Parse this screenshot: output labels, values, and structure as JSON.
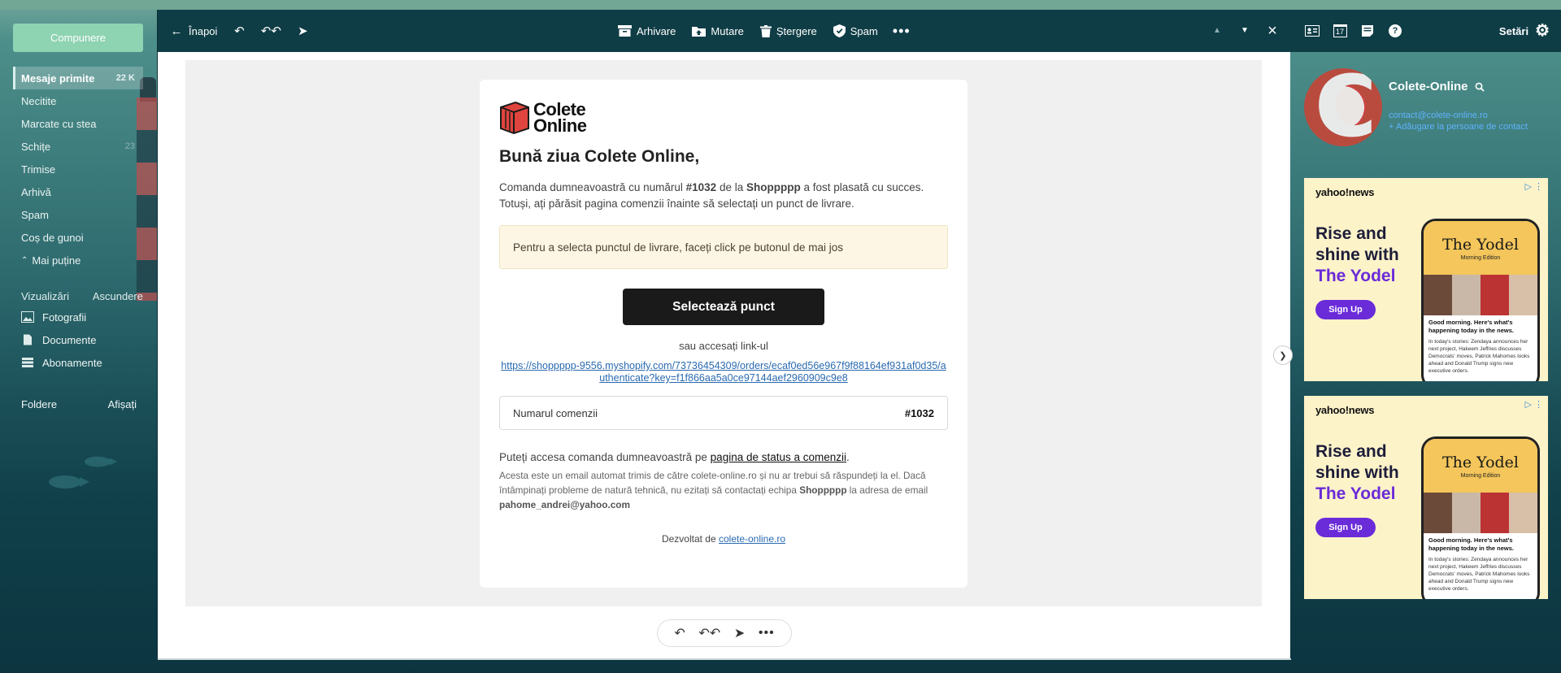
{
  "sidebar": {
    "compose_label": "Compunere",
    "items": [
      {
        "label": "Mesaje primite",
        "count": "22 K"
      },
      {
        "label": "Necitite",
        "count": ""
      },
      {
        "label": "Marcate cu stea",
        "count": ""
      },
      {
        "label": "Schițe",
        "count": "23"
      },
      {
        "label": "Trimise",
        "count": ""
      },
      {
        "label": "Arhivă",
        "count": ""
      },
      {
        "label": "Spam",
        "count": ""
      },
      {
        "label": "Coș de gunoi",
        "count": ""
      },
      {
        "label": "Mai puține",
        "count": ""
      }
    ],
    "views_label": "Vizualizări",
    "hide_label": "Ascundere",
    "views": [
      {
        "label": "Fotografii",
        "icon": "photo-icon"
      },
      {
        "label": "Documente",
        "icon": "document-icon"
      },
      {
        "label": "Abonamente",
        "icon": "subscriptions-icon"
      }
    ],
    "folders_label": "Foldere",
    "show_label": "Afișați"
  },
  "toolbar": {
    "back_label": "Înapoi",
    "archive_label": "Arhivare",
    "move_label": "Mutare",
    "delete_label": "Ștergere",
    "spam_label": "Spam"
  },
  "email": {
    "logo_line1": "Colete",
    "logo_line2": "Online",
    "greeting": "Bună ziua Colete Online,",
    "line1_pre": "Comanda dumneavoastră cu numărul ",
    "order_no": "#1032",
    "line1_mid": " de la ",
    "shop": "Shoppppp",
    "line1_post": " a fost plasată cu succes.",
    "line2": "Totuși, ați părăsit pagina comenzii înainte să selectați un punct de livrare.",
    "notice": "Pentru a selecta punctul de livrare, faceți click pe butonul de mai jos",
    "cta_label": "Selectează punct",
    "or_text": "sau accesați link-ul",
    "link": "https://shoppppp-9556.myshopify.com/73736454309/orders/ecaf0ed56e967f9f88164ef931af0d35/authenticate?key=f1f866aa5a0ce97144aef2960909c9e8",
    "order_label": "Numarul comenzii",
    "order_value": "#1032",
    "status_pre": "Puteți accesa comanda dumneavoastră pe ",
    "status_link": "pagina de status a comenzii",
    "status_post": ".",
    "disclaimer_pre": "Acesta este un email automat trimis de către colete-online.ro și nu ar trebui să răspundeți la el. Dacă întâmpinați probleme de natură tehnică, nu ezitați să contactați echipa ",
    "disclaimer_shop": "Shoppppp",
    "disclaimer_mid": " la adresa de email ",
    "disclaimer_email": "pahome_andrei@yahoo.com",
    "powered_pre": "Dezvoltat de ",
    "powered_link": "colete-online.ro"
  },
  "right_panel": {
    "settings_label": "Setări",
    "calendar_day": "17",
    "contact_name": "Colete-Online",
    "contact_email": "contact@colete-online.ro",
    "contact_add": "+ Adăugare la persoane de contact"
  },
  "ads": [
    {
      "brand": "yahoo!news",
      "head1": "Rise and",
      "head2": "shine with",
      "head3": "The Yodel",
      "signup": "Sign Up",
      "phone_title": "The Yodel",
      "phone_sub": "Morning Edition",
      "phone_text": "Good morning. Here's what's happening today in the news.",
      "phone_text2": "In today's stories: Zendaya announces her next project, Hakeem Jeffries discusses Democrats' moves, Patrick Mahomes looks ahead and Donald Trump signs new executive orders."
    },
    {
      "brand": "yahoo!news",
      "head1": "Rise and",
      "head2": "shine with",
      "head3": "The Yodel",
      "signup": "Sign Up",
      "phone_title": "The Yodel",
      "phone_sub": "Morning Edition",
      "phone_text": "Good morning. Here's what's happening today in the news.",
      "phone_text2": "In today's stories: Zendaya announces her next project, Hakeem Jeffries discusses Democrats' moves, Patrick Mahomes looks ahead and Donald Trump signs new executive orders."
    }
  ]
}
